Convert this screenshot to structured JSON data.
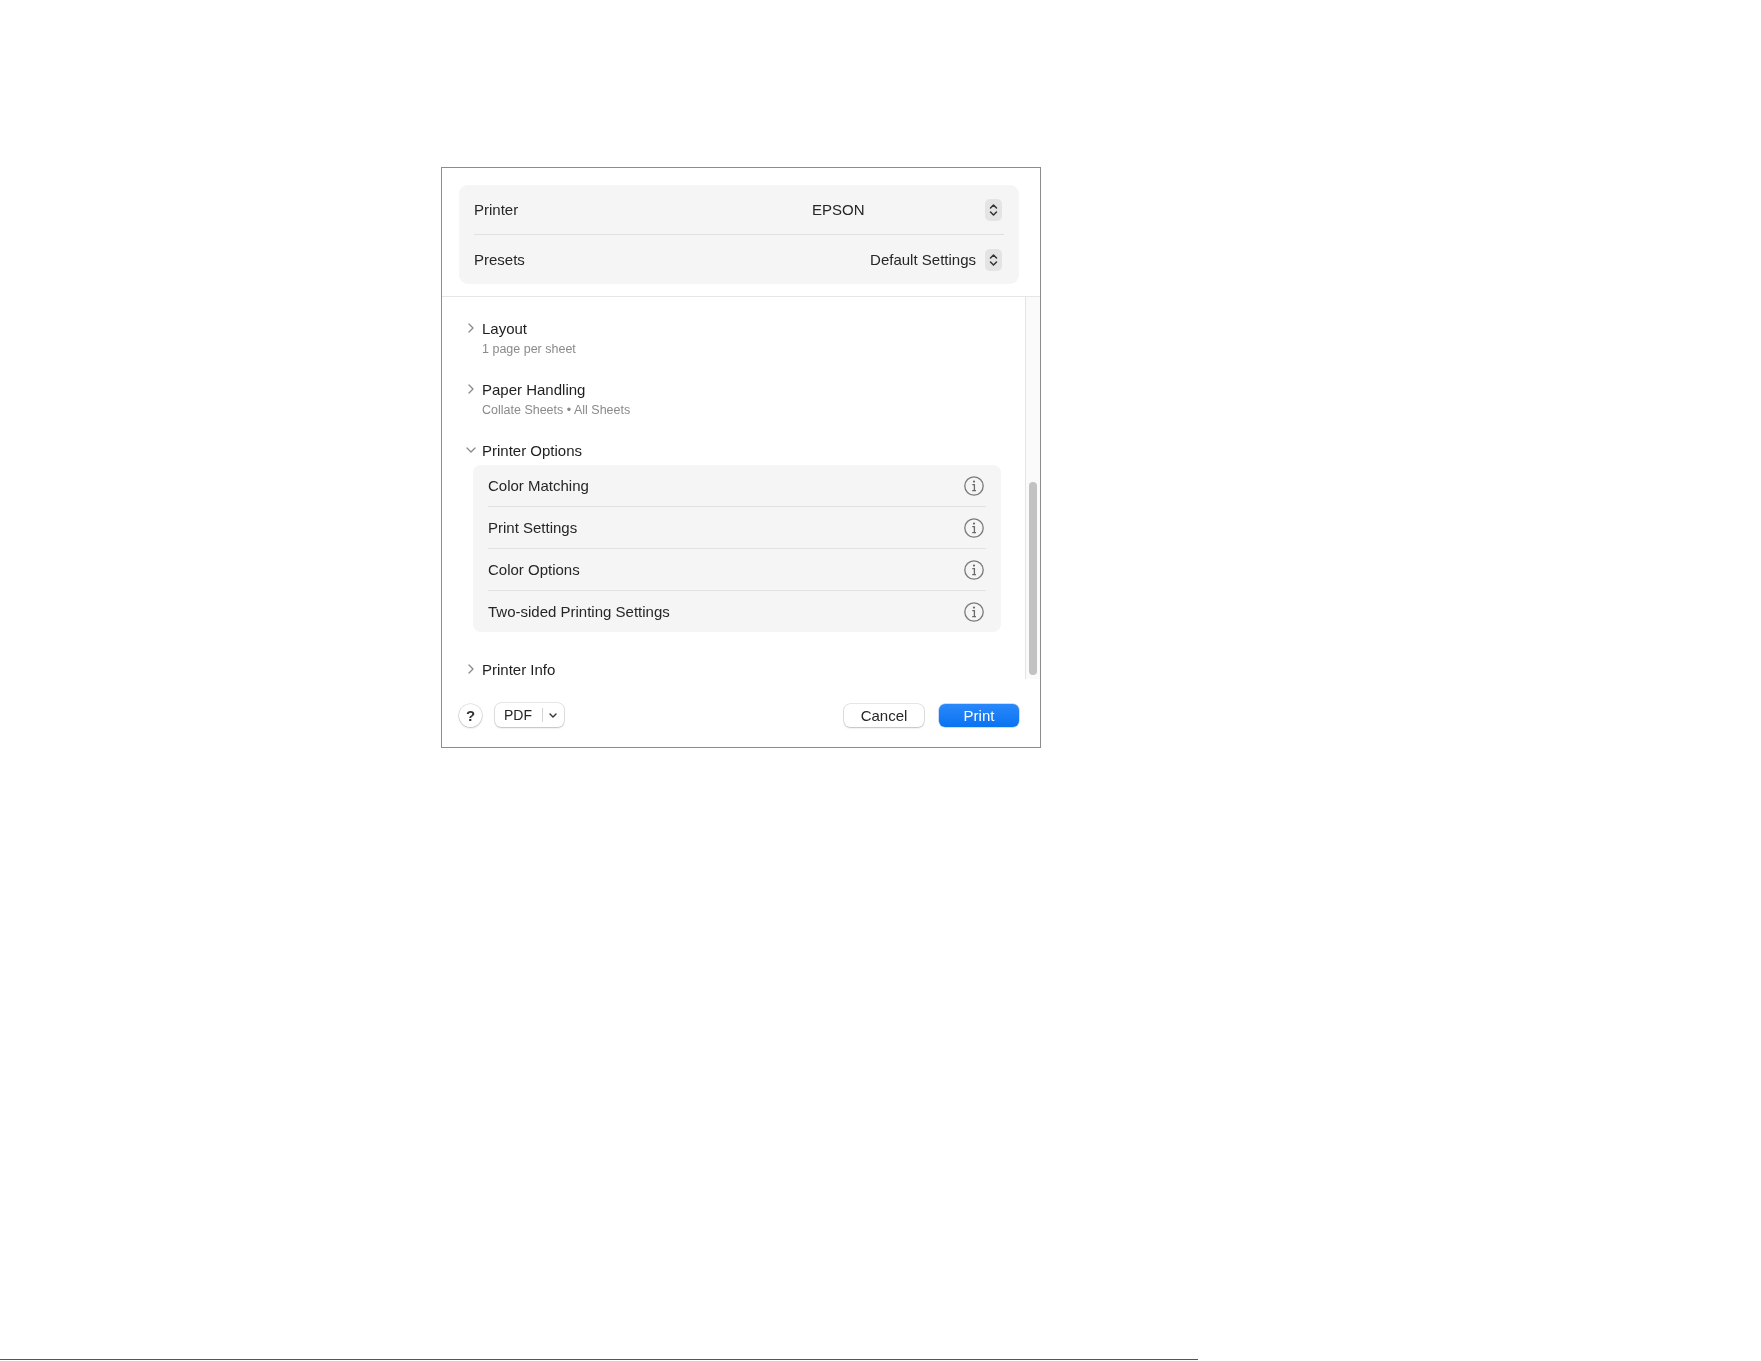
{
  "header": {
    "rows": [
      {
        "label": "Printer",
        "value": "EPSON"
      },
      {
        "label": "Presets",
        "value": "Default Settings"
      }
    ]
  },
  "sections": [
    {
      "title": "Layout",
      "subtitle": "1 page per sheet",
      "expanded": false
    },
    {
      "title": "Paper Handling",
      "subtitle": "Collate Sheets • All Sheets",
      "expanded": false
    },
    {
      "title": "Printer Options",
      "expanded": true,
      "children": [
        {
          "label": "Color Matching"
        },
        {
          "label": "Print Settings"
        },
        {
          "label": "Color Options"
        },
        {
          "label": "Two-sided Printing Settings"
        }
      ]
    },
    {
      "title": "Printer Info",
      "expanded": false
    }
  ],
  "footer": {
    "help": "?",
    "pdf": "PDF",
    "buttons": [
      {
        "label": "Cancel",
        "kind": "secondary"
      },
      {
        "label": "Print",
        "kind": "primary"
      }
    ]
  }
}
